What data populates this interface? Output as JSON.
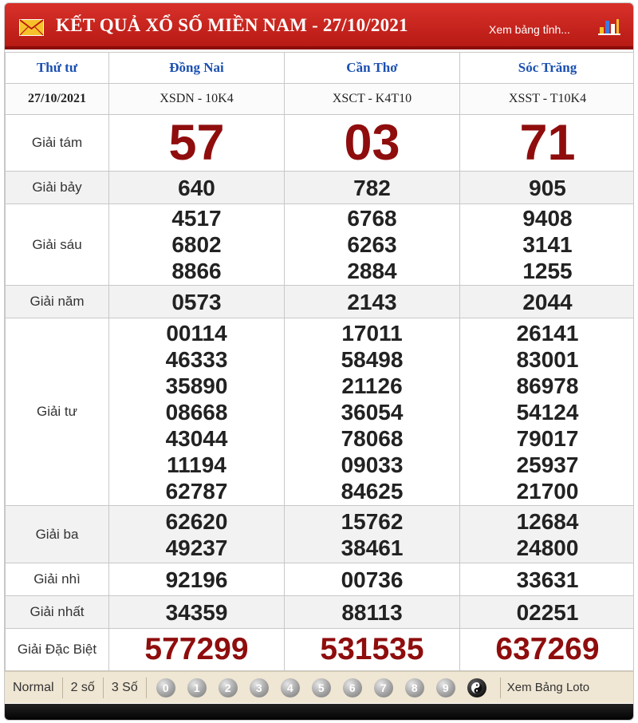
{
  "header": {
    "title": "KẾT QUẢ XỔ SỐ MIỀN NAM - 27/10/2021",
    "link": "Xem bảng tỉnh..."
  },
  "table": {
    "corner": "Thứ tư",
    "date": "27/10/2021",
    "provinces": [
      "Đồng Nai",
      "Cần Thơ",
      "Sóc Trăng"
    ],
    "codes": [
      "XSDN - 10K4",
      "XSCT - K4T10",
      "XSST - T10K4"
    ]
  },
  "prizes": {
    "g8": {
      "label": "Giải tám",
      "values": [
        [
          "57"
        ],
        [
          "03"
        ],
        [
          "71"
        ]
      ]
    },
    "g7": {
      "label": "Giải bảy",
      "values": [
        [
          "640"
        ],
        [
          "782"
        ],
        [
          "905"
        ]
      ]
    },
    "g6": {
      "label": "Giải sáu",
      "values": [
        [
          "4517",
          "6802",
          "8866"
        ],
        [
          "6768",
          "6263",
          "2884"
        ],
        [
          "9408",
          "3141",
          "1255"
        ]
      ]
    },
    "g5": {
      "label": "Giải năm",
      "values": [
        [
          "0573"
        ],
        [
          "2143"
        ],
        [
          "2044"
        ]
      ]
    },
    "g4": {
      "label": "Giải tư",
      "values": [
        [
          "00114",
          "46333",
          "35890",
          "08668",
          "43044",
          "11194",
          "62787"
        ],
        [
          "17011",
          "58498",
          "21126",
          "36054",
          "78068",
          "09033",
          "84625"
        ],
        [
          "26141",
          "83001",
          "86978",
          "54124",
          "79017",
          "25937",
          "21700"
        ]
      ]
    },
    "g3": {
      "label": "Giải ba",
      "values": [
        [
          "62620",
          "49237"
        ],
        [
          "15762",
          "38461"
        ],
        [
          "12684",
          "24800"
        ]
      ]
    },
    "g2": {
      "label": "Giải nhì",
      "values": [
        [
          "92196"
        ],
        [
          "00736"
        ],
        [
          "33631"
        ]
      ]
    },
    "g1": {
      "label": "Giải nhất",
      "values": [
        [
          "34359"
        ],
        [
          "88113"
        ],
        [
          "02251"
        ]
      ]
    },
    "db": {
      "label": "Giải Đặc Biệt",
      "values": [
        [
          "577299"
        ],
        [
          "531535"
        ],
        [
          "637269"
        ]
      ]
    }
  },
  "footer": {
    "options": [
      "Normal",
      "2 số",
      "3 Số"
    ],
    "digits": [
      "0",
      "1",
      "2",
      "3",
      "4",
      "5",
      "6",
      "7",
      "8",
      "9"
    ],
    "loto_link": "Xem Bảng Loto"
  },
  "colors": {
    "header_red": "#c9231c",
    "prize_red": "#8f0d0d",
    "province_blue": "#1a4fb0",
    "footer_beige": "#efe6d3"
  },
  "icons": {
    "mail": "envelope-icon",
    "chart": "bar-chart-icon",
    "yinyang": "yin-yang-icon"
  }
}
